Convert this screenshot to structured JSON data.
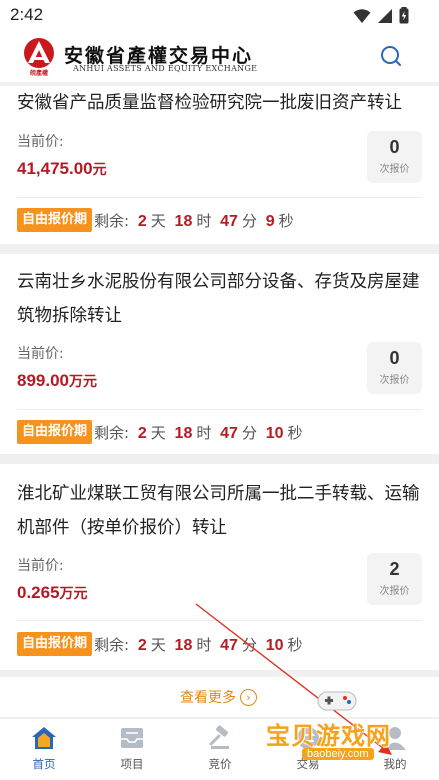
{
  "status": {
    "time": "2:42"
  },
  "header": {
    "logo_cn": "安徽省產權交易中心",
    "logo_en": "ANHUI ASSETS AND EQUITY EXCHANGE",
    "logo_badge": "皖產權"
  },
  "listings": [
    {
      "title": "安徽省产品质量监督检验研究院一批废旧资产转让",
      "price_label": "当前价:",
      "price_value": "41,475.00",
      "price_unit": "元",
      "bid_count": "0",
      "bid_label": "次报价",
      "tag": "自由报价期",
      "remain_label": "剩余:",
      "days": "2",
      "days_unit": "天",
      "hours": "18",
      "hours_unit": "时",
      "minutes": "47",
      "minutes_unit": "分",
      "seconds": "9",
      "seconds_unit": "秒"
    },
    {
      "title": "云南壮乡水泥股份有限公司部分设备、存货及房屋建筑物拆除转让",
      "price_label": "当前价:",
      "price_value": "899.00",
      "price_unit": "万元",
      "bid_count": "0",
      "bid_label": "次报价",
      "tag": "自由报价期",
      "remain_label": "剩余:",
      "days": "2",
      "days_unit": "天",
      "hours": "18",
      "hours_unit": "时",
      "minutes": "47",
      "minutes_unit": "分",
      "seconds": "10",
      "seconds_unit": "秒"
    },
    {
      "title": "淮北矿业煤联工贸有限公司所属一批二手转载、运输机部件（按单价报价）转让",
      "price_label": "当前价:",
      "price_value": "0.265",
      "price_unit": "万元",
      "bid_count": "2",
      "bid_label": "次报价",
      "tag": "自由报价期",
      "remain_label": "剩余:",
      "days": "2",
      "days_unit": "天",
      "hours": "18",
      "hours_unit": "时",
      "minutes": "47",
      "minutes_unit": "分",
      "seconds": "10",
      "seconds_unit": "秒"
    }
  ],
  "more": {
    "label": "查看更多",
    "icon": "chevron-right-circle-icon"
  },
  "tabs": [
    {
      "label": "首页",
      "icon": "home-icon",
      "active": true
    },
    {
      "label": "项目",
      "icon": "inbox-icon",
      "active": false
    },
    {
      "label": "竞价",
      "icon": "gavel-icon",
      "active": false
    },
    {
      "label": "交易",
      "icon": "exchange-icon",
      "active": false
    },
    {
      "label": "我的",
      "icon": "user-icon",
      "active": false
    }
  ],
  "watermark": {
    "text": "宝贝游戏网",
    "url": "baobeiy.com"
  },
  "colors": {
    "accent_red": "#b41b24",
    "tag_orange": "#f5931e",
    "tab_active": "#2a66b8"
  }
}
